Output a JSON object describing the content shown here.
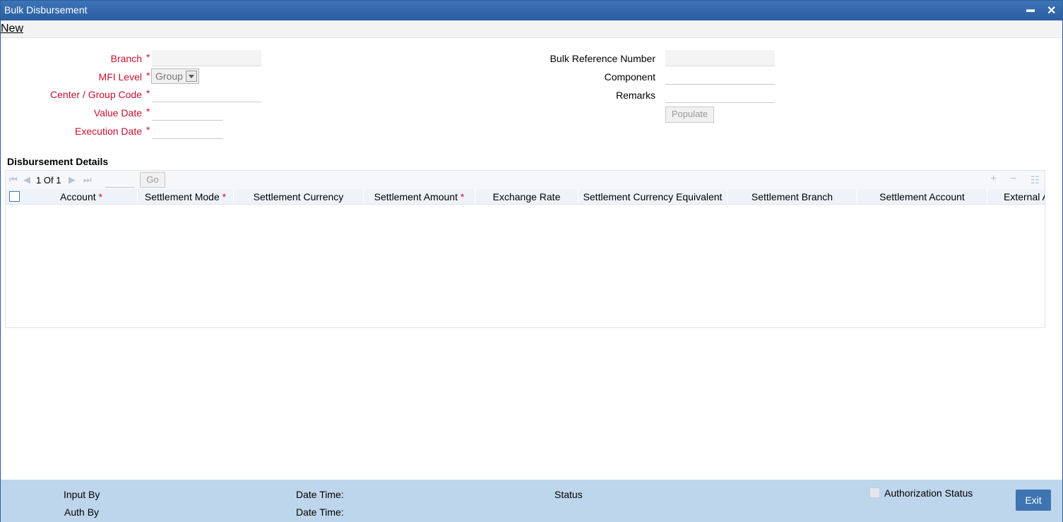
{
  "window": {
    "title": "Bulk Disbursement",
    "minimize": "▬",
    "close": "✕"
  },
  "menu": {
    "new": "New"
  },
  "form": {
    "branch": {
      "label": "Branch",
      "value": ""
    },
    "mfi_level": {
      "label": "MFI Level",
      "selected": "Group"
    },
    "center_group_code": {
      "label": "Center / Group Code",
      "value": ""
    },
    "value_date": {
      "label": "Value Date",
      "value": ""
    },
    "execution_date": {
      "label": "Execution Date",
      "value": ""
    },
    "bulk_reference_number": {
      "label": "Bulk Reference Number",
      "value": ""
    },
    "component": {
      "label": "Component",
      "value": ""
    },
    "remarks": {
      "label": "Remarks",
      "value": ""
    },
    "populate_button": "Populate",
    "required_mark": "*"
  },
  "grid": {
    "title": "Disbursement Details",
    "pagination": {
      "current": "1",
      "of_label": "Of",
      "total": "1",
      "go_button": "Go"
    },
    "columns": [
      {
        "label": "Account",
        "required": true
      },
      {
        "label": "Settlement Mode",
        "required": true
      },
      {
        "label": "Settlement Currency",
        "required": false
      },
      {
        "label": "Settlement Amount",
        "required": true
      },
      {
        "label": "Exchange Rate",
        "required": false
      },
      {
        "label": "Settlement Currency Equivalent",
        "required": false
      },
      {
        "label": "Settlement Branch",
        "required": false
      },
      {
        "label": "Settlement Account",
        "required": false
      },
      {
        "label": "External A",
        "required": false
      }
    ],
    "rows": []
  },
  "footer": {
    "input_by": "Input By",
    "auth_by": "Auth By",
    "date_time_1": "Date Time:",
    "date_time_2": "Date Time:",
    "status": "Status",
    "authorization_status": "Authorization Status",
    "exit_button": "Exit"
  },
  "colors": {
    "title_bar": "#2a5da0",
    "required": "#c8102e",
    "footer": "#bed6ec",
    "exit_button": "#3f74b2"
  }
}
